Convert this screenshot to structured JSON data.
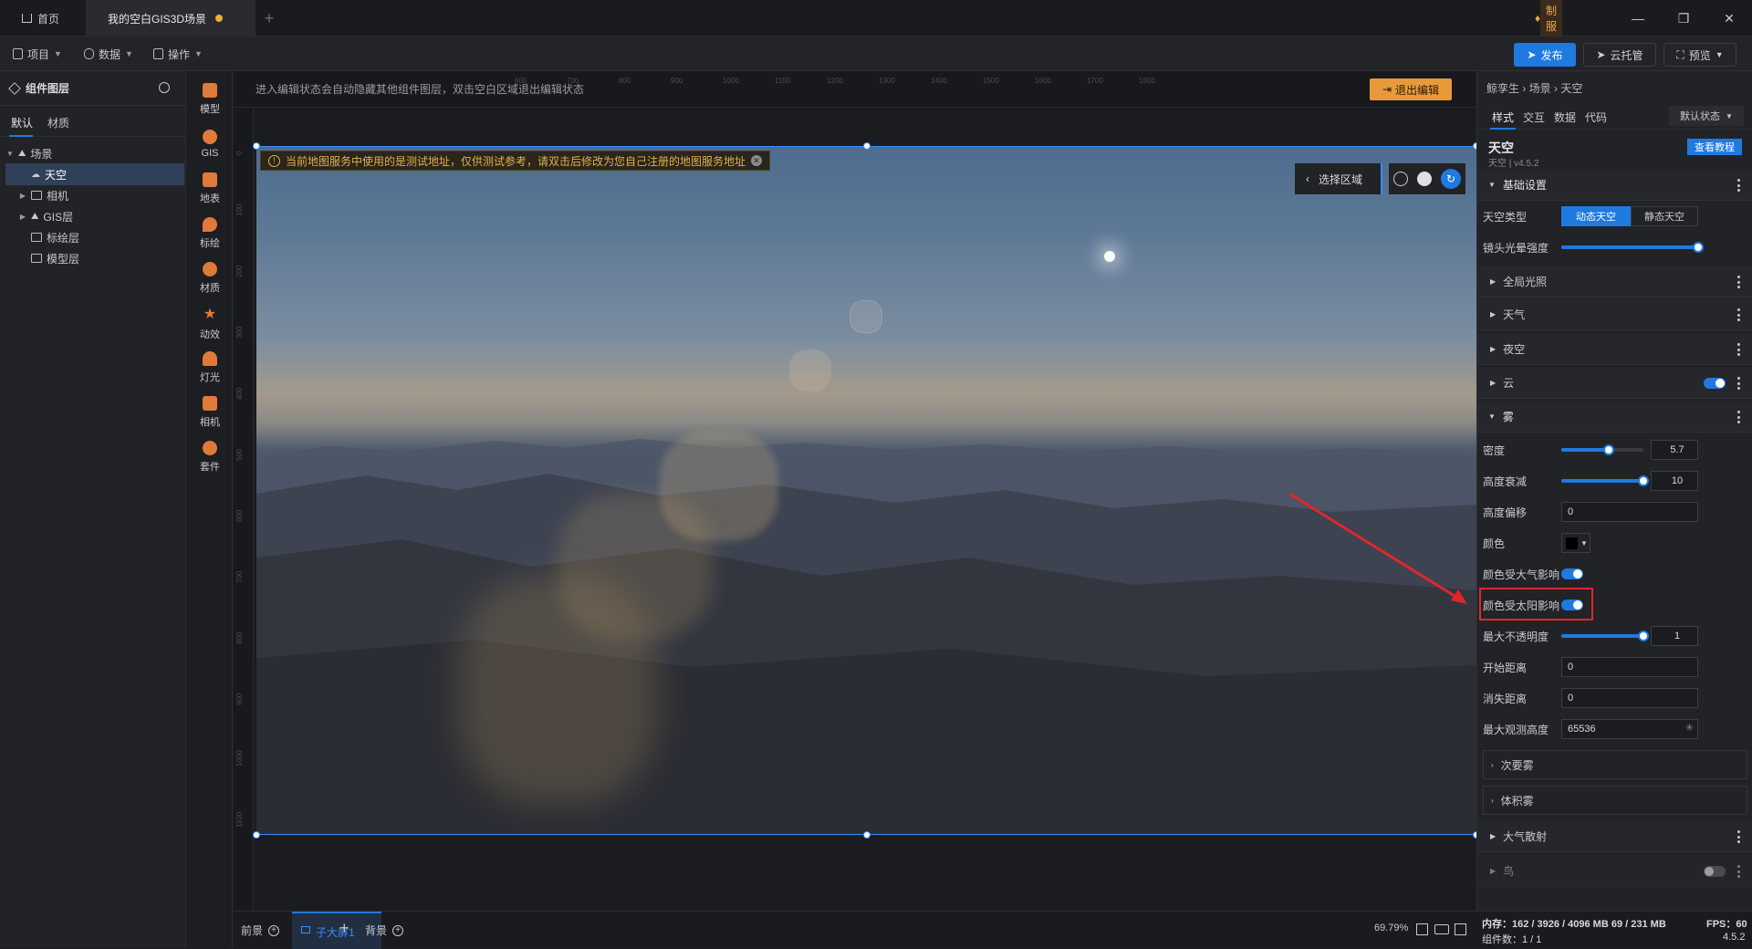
{
  "titlebar": {
    "home_tab": "首页",
    "scene_tab": "我的空白GIS3D场景",
    "custom_service": "定制服务"
  },
  "toolbar": {
    "menu_project": "项目",
    "menu_data": "数据",
    "menu_operate": "操作",
    "publish": "发布",
    "cloud": "云托管",
    "preview": "预览"
  },
  "layers": {
    "title": "组件图层",
    "tab_default": "默认",
    "tab_material": "材质",
    "items": [
      {
        "label": "场景"
      },
      {
        "label": "天空"
      },
      {
        "label": "相机"
      },
      {
        "label": "GIS层"
      },
      {
        "label": "标绘层"
      },
      {
        "label": "模型层"
      }
    ]
  },
  "components": [
    "模型",
    "GIS",
    "地表",
    "标绘",
    "材质",
    "动效",
    "灯光",
    "相机",
    "套件"
  ],
  "canvas": {
    "hint": "进入编辑状态会自动隐藏其他组件图层，双击空白区域退出编辑状态",
    "exit_edit": "退出编辑",
    "warning": "当前地图服务中使用的是测试地址，仅供测试参考，请双击后修改为您自己注册的地图服务地址",
    "select_area": "选择区域",
    "ruler_top": [
      "600",
      "700",
      "800",
      "900",
      "1000",
      "1100",
      "1200",
      "1300",
      "1400",
      "1500",
      "1600",
      "1700",
      "1800"
    ],
    "ruler_left": [
      "0",
      "100",
      "200",
      "300",
      "400",
      "500",
      "600",
      "700",
      "800",
      "900",
      "1000",
      "1100"
    ]
  },
  "bottombar": {
    "foreground": "前景",
    "sub_screen": "子大屏1",
    "background": "背景",
    "zoom": "69.79%"
  },
  "inspector": {
    "breadcrumb": "鲸孪生 › 场景 › 天空",
    "tabs": [
      "样式",
      "交互",
      "数据",
      "代码"
    ],
    "state": "默认状态",
    "name": "天空",
    "version": "天空 | v4.5.2",
    "tutorial": "查看教程",
    "basic_settings": "基础设置",
    "sky_type_label": "天空类型",
    "sky_type_dynamic": "动态天空",
    "sky_type_static": "静态天空",
    "lens_flare_label": "镜头光晕强度",
    "global_light": "全局光照",
    "weather": "天气",
    "night_sky": "夜空",
    "cloud": "云",
    "fog": "雾",
    "density_label": "密度",
    "density_value": "5.7",
    "height_falloff_label": "高度衰减",
    "height_falloff_value": "10",
    "height_offset_label": "高度偏移",
    "height_offset_value": "0",
    "color_label": "颜色",
    "color_atmos_label": "颜色受大气影响",
    "color_sun_label": "颜色受太阳影响",
    "max_opacity_label": "最大不透明度",
    "max_opacity_value": "1",
    "start_distance_label": "开始距离",
    "start_distance_value": "0",
    "cutoff_distance_label": "消失距离",
    "cutoff_distance_value": "0",
    "max_height_label": "最大观测高度",
    "max_height_value": "65536",
    "secondary_fog": "次要雾",
    "volumetric_fog": "体积雾",
    "atmos_scattering": "大气散射",
    "birds": "鸟"
  },
  "status": {
    "memory": "内存：162 / 3926 / 4096 MB  69 / 231 MB",
    "fps": "FPS：60",
    "components": "组件数：1 / 1",
    "version": "4.5.2"
  },
  "colors": {
    "accent": "#1f7ae0",
    "highlight_box": "#e0262a",
    "exit_button": "#e89a3a"
  }
}
